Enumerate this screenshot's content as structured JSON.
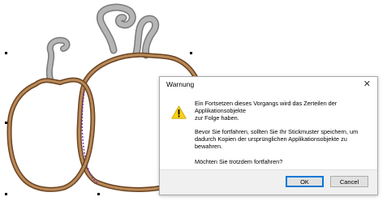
{
  "dialog": {
    "title": "Warnung",
    "close_glyph": "✕",
    "icon": "warning-icon",
    "line1": "Ein Fortsetzen dieses Vorgangs wird das Zerteilen der",
    "line2": "Applikationsobjekte",
    "line3": "zur Folge haben.",
    "paragraph2": "Bevor Sie fortfahren, sollten Sie Ihr Stickmuster speichern, um dadurch Kopien der ursprünglichen Applikationsobjekte zu bewahren.",
    "paragraph3": "Möchten Sie trotzdem fortfahren?",
    "ok_label": "OK",
    "cancel_label": "Cancel"
  },
  "colors": {
    "outline": "#8b5a2b",
    "stem": "#9b9b9b",
    "accent": "#0078d7",
    "dotted": "#7b2fbf"
  }
}
